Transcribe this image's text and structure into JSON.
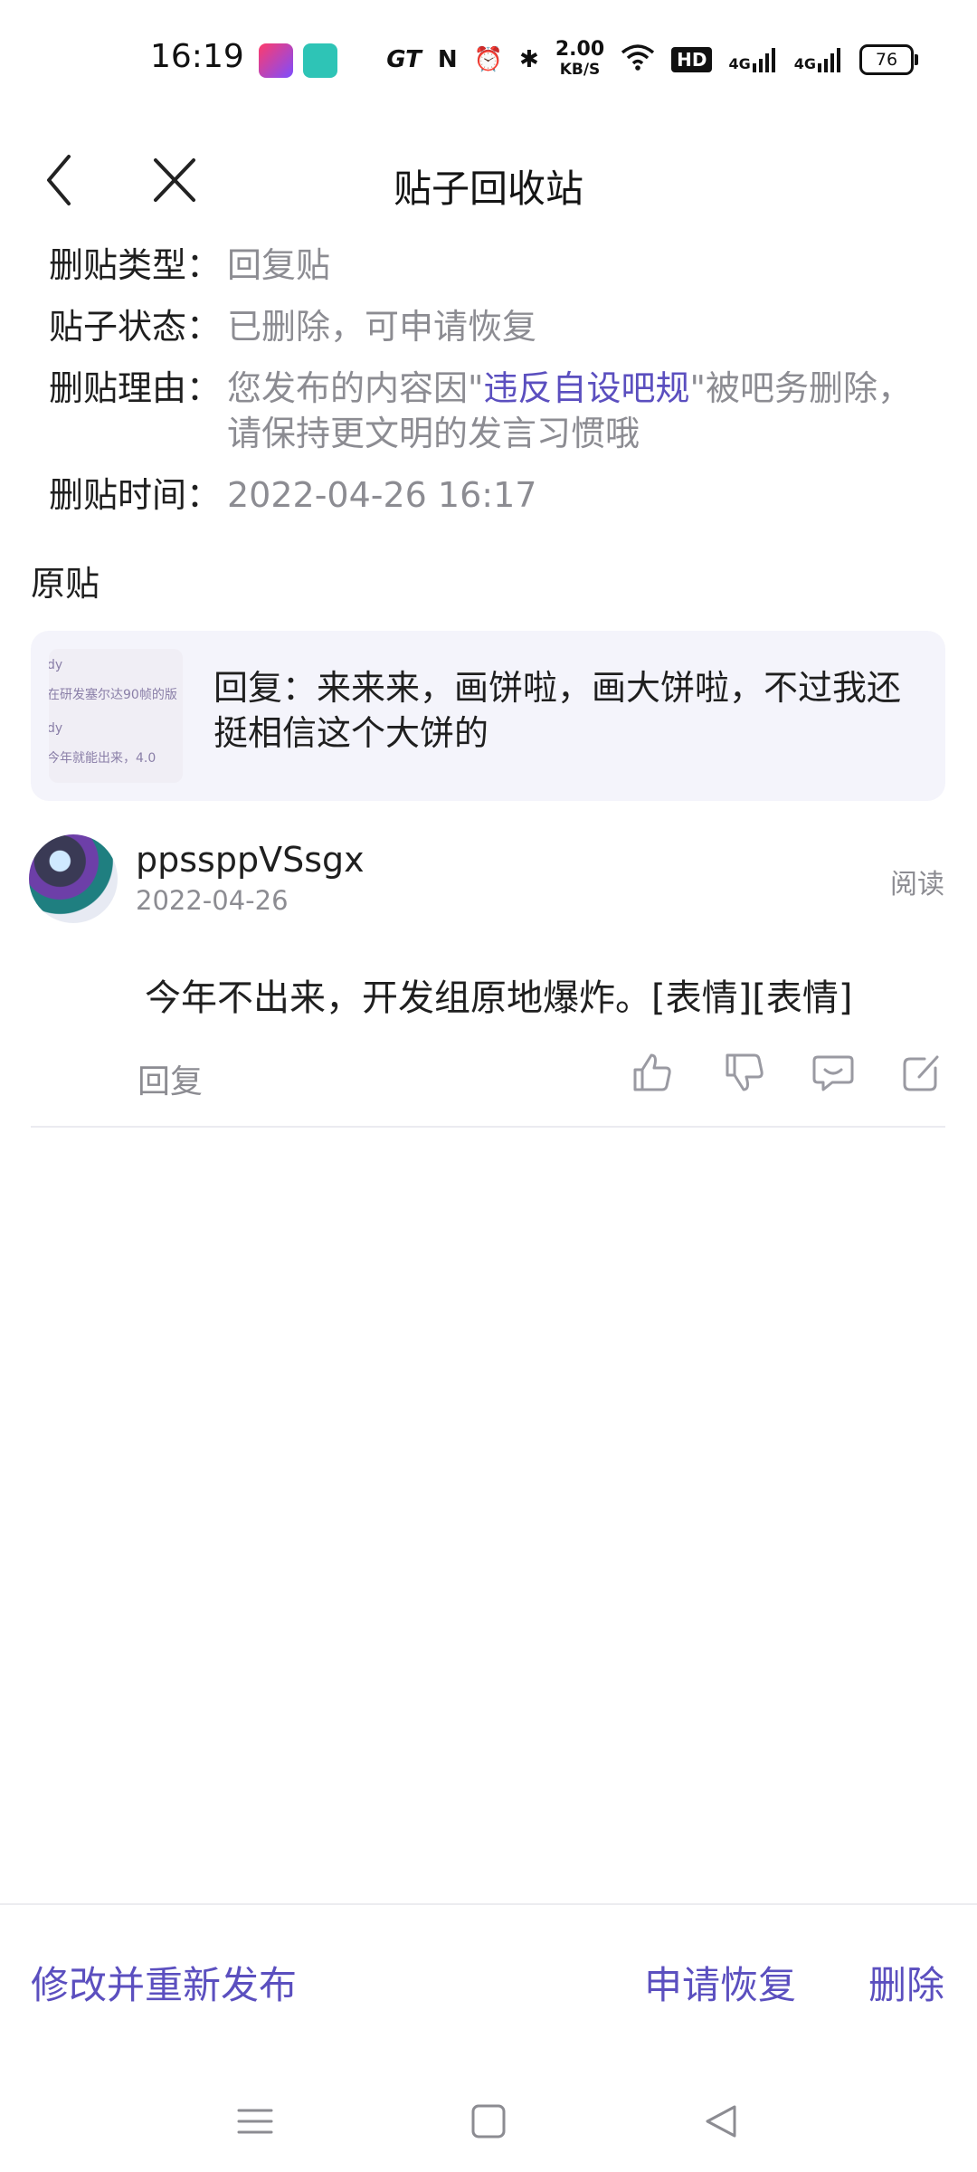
{
  "status_bar": {
    "time": "16:19",
    "net_speed_value": "2.00",
    "net_speed_unit": "KB/S",
    "hd_badge": "HD",
    "signal_1": "4G",
    "signal_2": "4G",
    "battery": "76",
    "icons": [
      "gt-icon",
      "nfc-icon",
      "alarm-icon",
      "bluetooth-icon",
      "wifi-icon",
      "signal-icon",
      "battery-icon"
    ]
  },
  "nav": {
    "title": "贴子回收站"
  },
  "info": {
    "type_label": "删贴类型：",
    "type_value": "回复贴",
    "status_label": "贴子状态：",
    "status_value": "已删除，可申请恢复",
    "reason_label": "删贴理由：",
    "reason_prefix": "您发布的内容因\"",
    "reason_rule": "违反自设吧规",
    "reason_suffix": "\"被吧务删除，请保持更文明的发言习惯哦",
    "time_label": "删贴时间：",
    "time_value": "2022-04-26 16:17"
  },
  "original": {
    "label": "原贴",
    "thumb_lines": [
      "dy",
      "在研发塞尔达90帧的版",
      "dy",
      "今年就能出来，4.0"
    ],
    "quote": "回复：来来来，画饼啦，画大饼啦，不过我还挺相信这个大饼的"
  },
  "post": {
    "author": "ppssppVSsgx",
    "date": "2022-04-26",
    "read_label": "阅读",
    "content": "今年不出来，开发组原地爆炸。[表情][表情]",
    "reply_label": "回复"
  },
  "actions": {
    "repost": "修改并重新发布",
    "restore": "申请恢复",
    "delete": "删除"
  },
  "colors": {
    "accent": "#5b4fbf",
    "muted": "#8c8c92",
    "card_bg": "#f4f4fb"
  }
}
